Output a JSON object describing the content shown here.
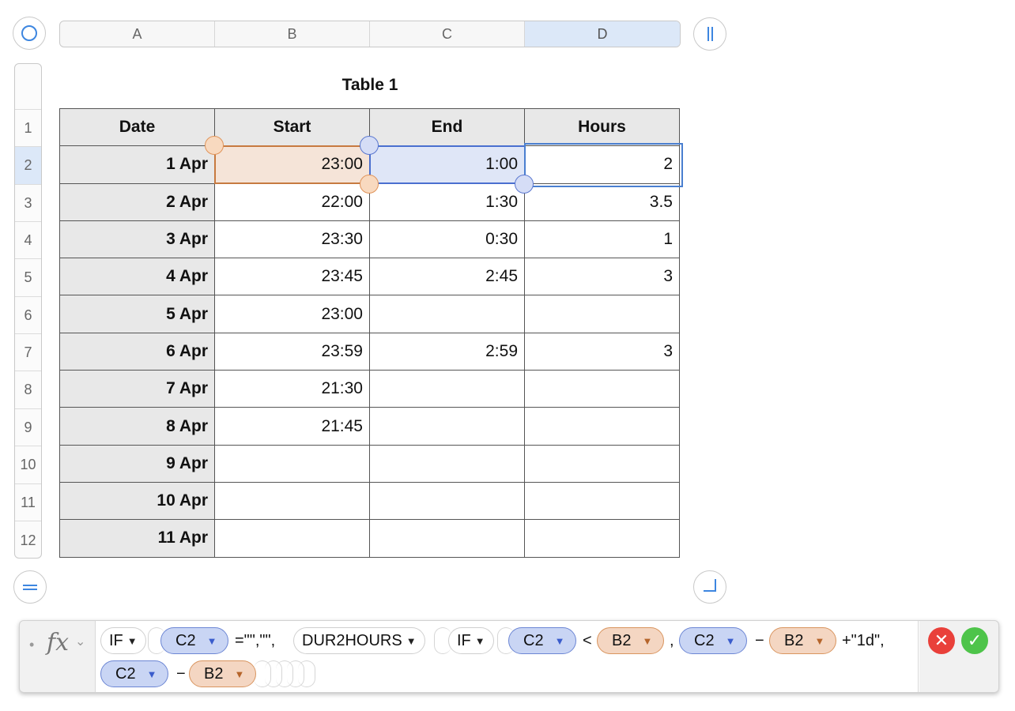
{
  "columns": [
    {
      "label": "A",
      "selected": false
    },
    {
      "label": "B",
      "selected": false
    },
    {
      "label": "C",
      "selected": false
    },
    {
      "label": "D",
      "selected": true
    }
  ],
  "row_numbers": [
    "1",
    "2",
    "3",
    "4",
    "5",
    "6",
    "7",
    "8",
    "9",
    "10",
    "11",
    "12"
  ],
  "selected_row": "2",
  "table": {
    "title": "Table 1",
    "headers": [
      "Date",
      "Start",
      "End",
      "Hours"
    ],
    "rows": [
      [
        "1 Apr",
        "23:00",
        "1:00",
        "2"
      ],
      [
        "2 Apr",
        "22:00",
        "1:30",
        "3.5"
      ],
      [
        "3 Apr",
        "23:30",
        "0:30",
        "1"
      ],
      [
        "4 Apr",
        "23:45",
        "2:45",
        "3"
      ],
      [
        "5 Apr",
        "23:00",
        "",
        ""
      ],
      [
        "6 Apr",
        "23:59",
        "2:59",
        "3"
      ],
      [
        "7 Apr",
        "21:30",
        "",
        ""
      ],
      [
        "8 Apr",
        "21:45",
        "",
        ""
      ],
      [
        "9 Apr",
        "",
        "",
        ""
      ],
      [
        "10 Apr",
        "",
        "",
        ""
      ],
      [
        "11 Apr",
        "",
        "",
        ""
      ]
    ]
  },
  "formula": {
    "fx_label": "fx",
    "fn_if": "IF",
    "fn_dur2hours": "DUR2HOURS",
    "ref_c2": "C2",
    "ref_b2": "B2",
    "t_eq_empty": "=\"\",\"\",",
    "t_lt": "<",
    "t_comma": ",",
    "t_minus": "−",
    "t_plus_1d": "+\"1d\",",
    "t_minus2": "−"
  },
  "colors": {
    "ref_b": "#f4d6c2",
    "ref_c": "#c9d5f4",
    "cancel": "#e9403a",
    "accept": "#4ec44a",
    "selection": "#4a7fd0"
  }
}
